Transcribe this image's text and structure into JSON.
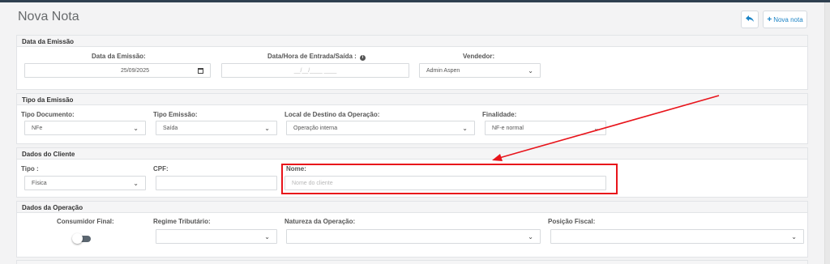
{
  "header": {
    "title": "Nova Nota",
    "back_icon": "reply-arrow-icon",
    "new_button_icon": "plus-icon",
    "new_button_label": "Nova nota"
  },
  "sections": {
    "emissao": {
      "title": "Data da Emissão",
      "date_label": "Data da Emissão:",
      "date_value": "25/09/2025",
      "datetime_label": "Data/Hora de Entrada/Saída :",
      "datetime_placeholder": "__/__/____ ____",
      "seller_label": "Vendedor:",
      "seller_value": "Admin Aspen"
    },
    "tipo": {
      "title": "Tipo da Emissão",
      "doc_label": "Tipo Documento:",
      "doc_value": "NFe",
      "emission_label": "Tipo Emissão:",
      "emission_value": "Saída",
      "destino_label": "Local de Destino da Operação:",
      "destino_value": "Operação interna",
      "finalidade_label": "Finalidade:",
      "finalidade_value": "NF-e normal"
    },
    "cliente": {
      "title": "Dados do Cliente",
      "tipo_label": "Tipo :",
      "tipo_value": "Física",
      "cpf_label": "CPF:",
      "cpf_value": "",
      "nome_label": "Nome:",
      "nome_placeholder": "Nome do cliente"
    },
    "operacao": {
      "title": "Dados da Operação",
      "consumidor_label": "Consumidor Final:",
      "consumidor_on": false,
      "regime_label": "Regime Tributário:",
      "regime_value": "",
      "natureza_label": "Natureza da Operação:",
      "natureza_value": "",
      "posicao_label": "Posição Fiscal:",
      "posicao_value": ""
    }
  },
  "annotation": {
    "color": "#e8141b"
  },
  "colors": {
    "accent": "#1c84c6",
    "topbar": "#2f4050"
  }
}
